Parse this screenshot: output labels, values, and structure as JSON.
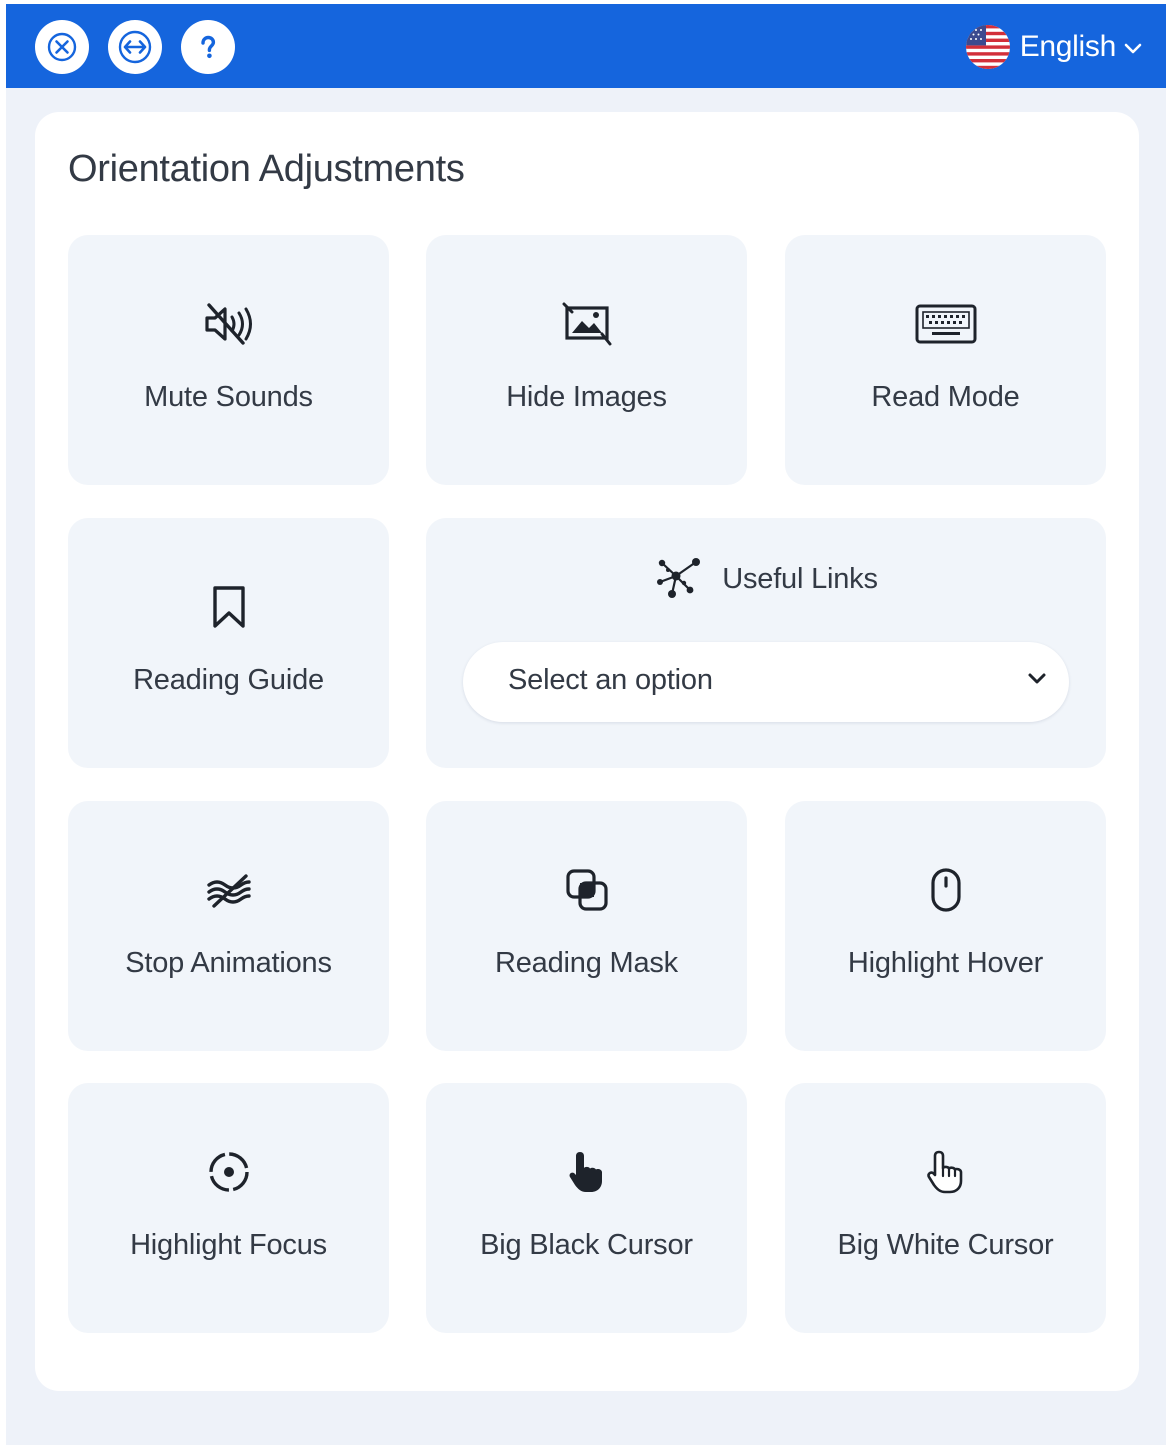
{
  "header": {
    "close_icon": "close-icon",
    "move_icon": "arrows-left-right-icon",
    "help_icon": "question-icon",
    "language": {
      "label": "English",
      "flag_icon": "us-flag-icon",
      "chevron_icon": "chevron-down-icon"
    }
  },
  "colors": {
    "accent": "#1565dd",
    "page_background": "#eef2f9",
    "tile_background": "#f1f5fa",
    "text": "#333a45"
  },
  "section": {
    "title": "Orientation Adjustments"
  },
  "tiles": [
    {
      "label": "Mute Sounds",
      "icon": "speaker-mute-icon"
    },
    {
      "label": "Hide Images",
      "icon": "image-crossed-icon"
    },
    {
      "label": "Read Mode",
      "icon": "keyboard-icon"
    },
    {
      "label": "Reading Guide",
      "icon": "bookmark-icon"
    },
    {
      "label": "Stop Animations",
      "icon": "waves-crossed-icon"
    },
    {
      "label": "Reading Mask",
      "icon": "overlapping-squares-icon"
    },
    {
      "label": "Highlight Hover",
      "icon": "mouse-icon"
    },
    {
      "label": "Highlight Focus",
      "icon": "focus-circle-icon"
    },
    {
      "label": "Big Black Cursor",
      "icon": "black-hand-cursor-icon"
    },
    {
      "label": "Big White Cursor",
      "icon": "white-hand-cursor-icon"
    }
  ],
  "useful_links": {
    "label": "Useful Links",
    "icon": "network-nodes-icon",
    "select": {
      "value": "Select an option",
      "chevron_icon": "chevron-down-icon"
    }
  }
}
